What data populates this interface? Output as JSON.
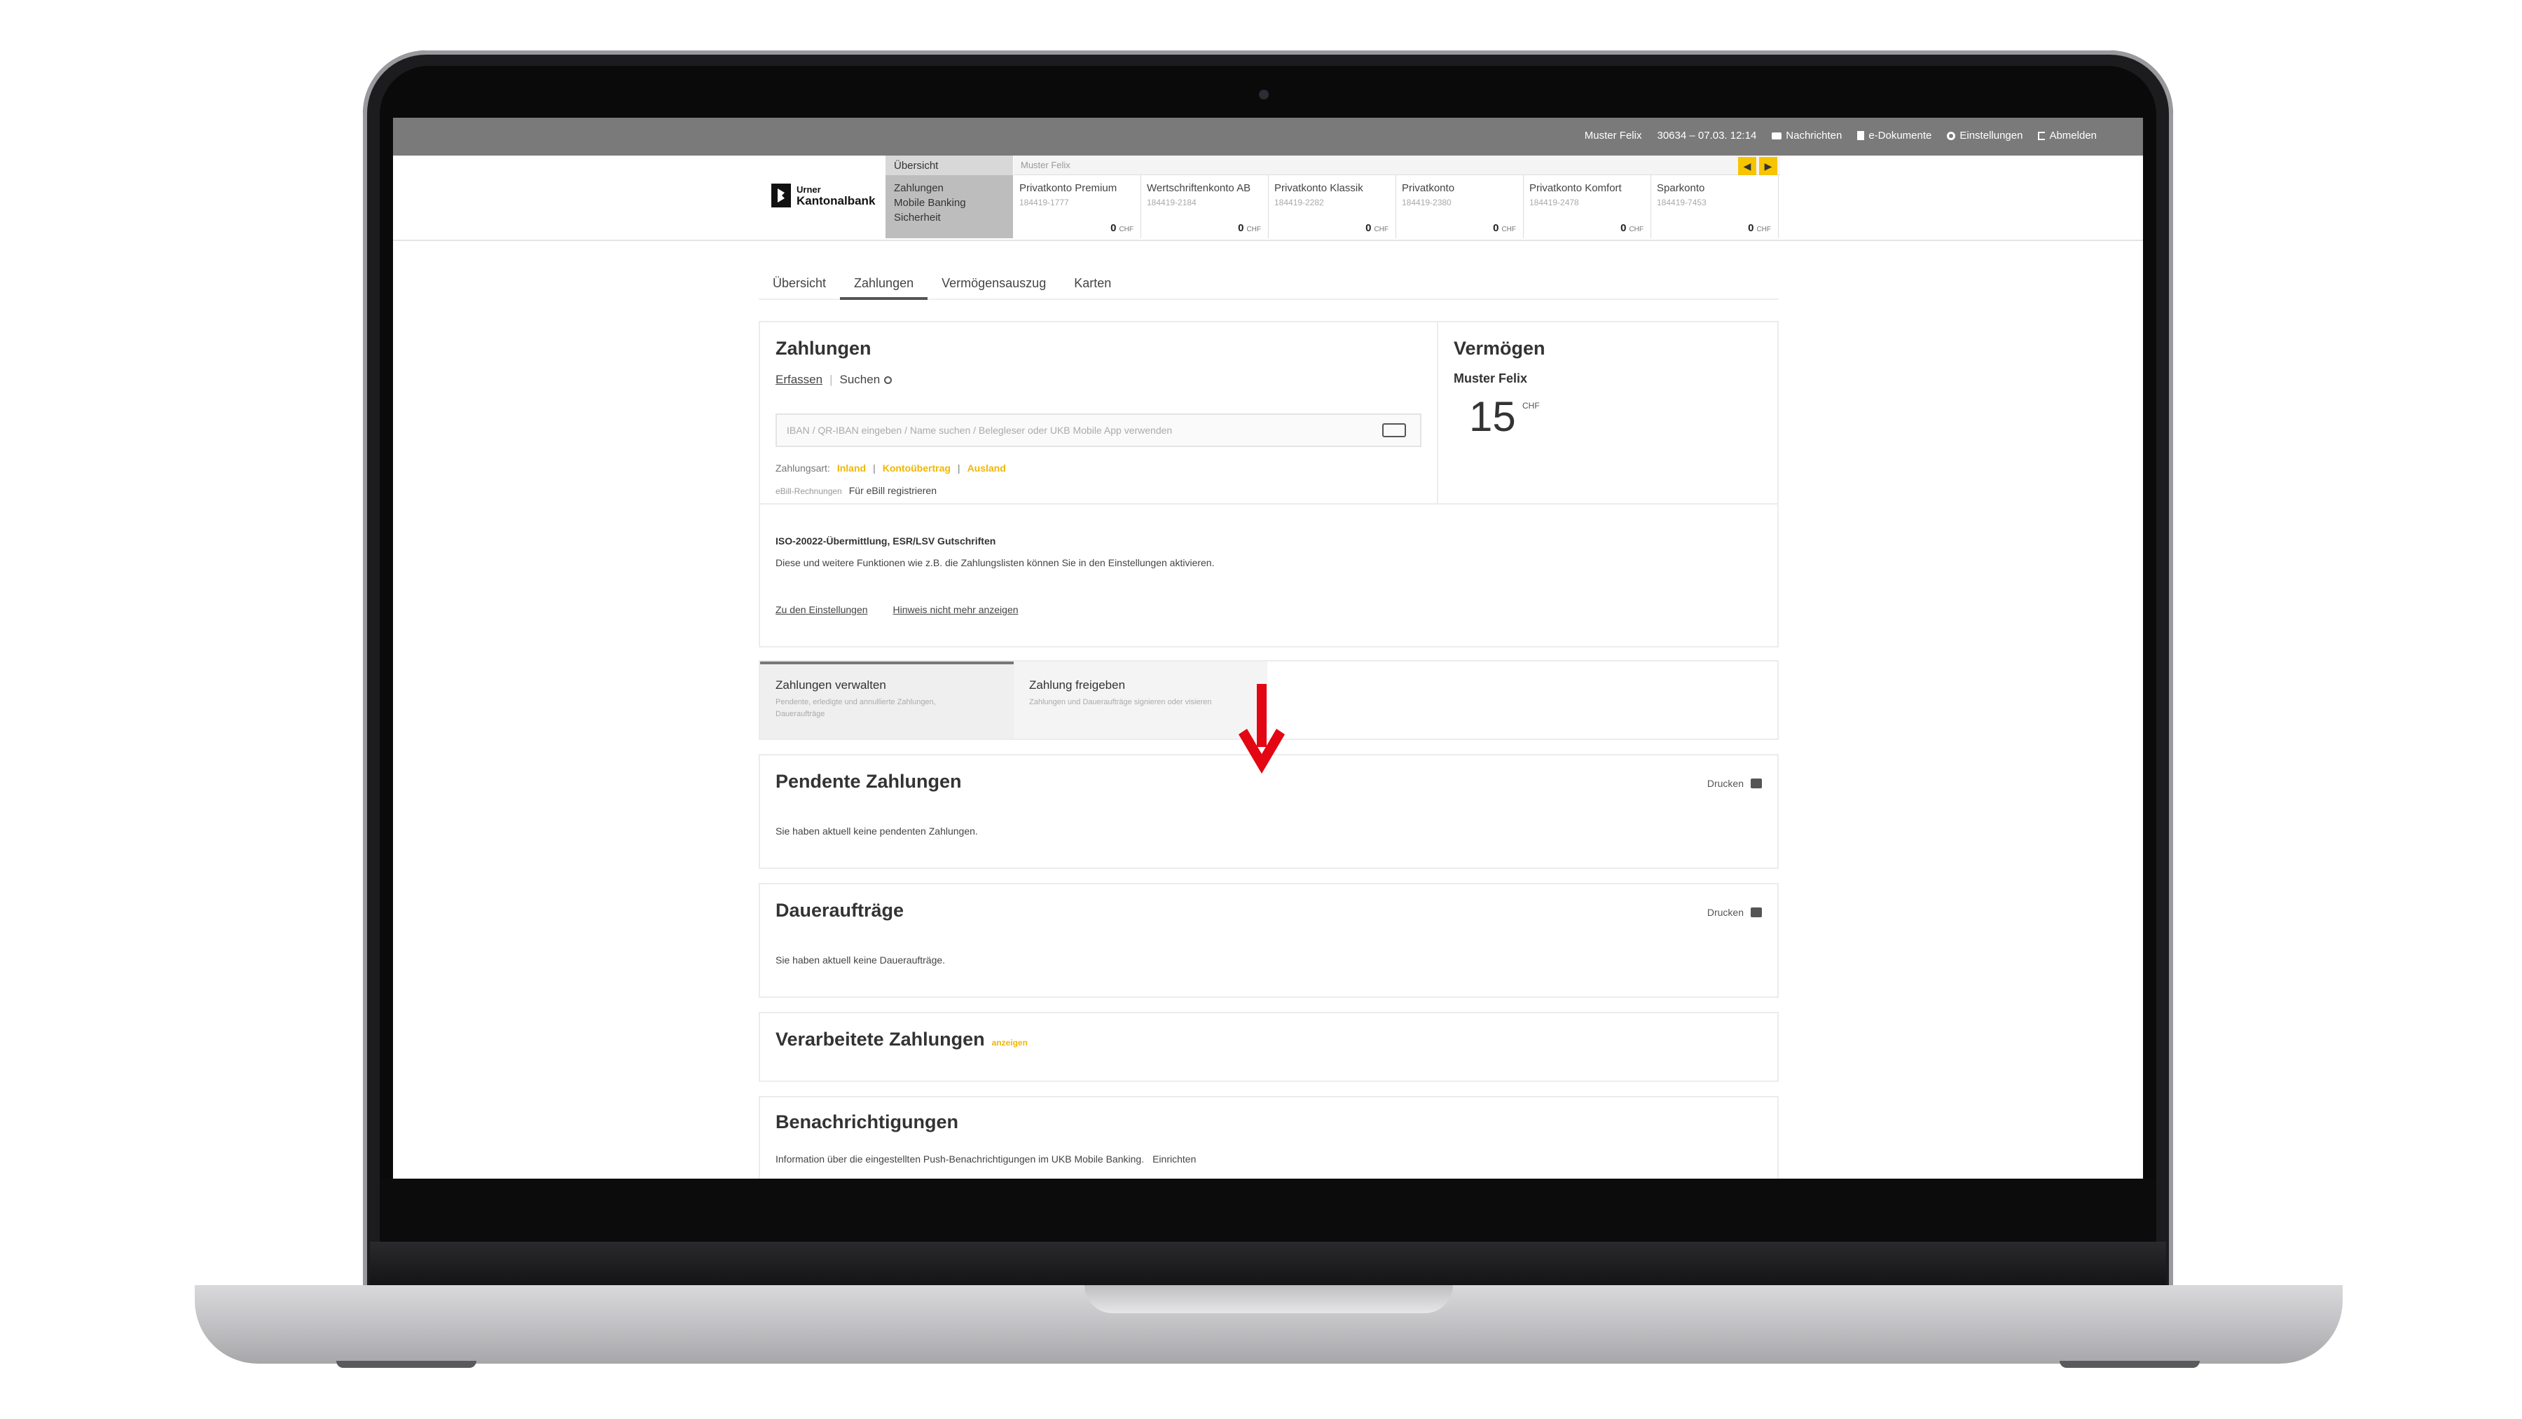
{
  "topbar": {
    "user": "Muster Felix",
    "session": "30634 – 07.03. 12:14",
    "messages": "Nachrichten",
    "documents": "e-Dokumente",
    "settings": "Einstellungen",
    "logout": "Abmelden"
  },
  "logo": {
    "line1": "Urner",
    "line2": "Kantonalbank"
  },
  "nav_menu": [
    "Übersicht",
    "Zahlungen",
    "Mobile Banking",
    "Sicherheit"
  ],
  "accounts_header": "Muster Felix",
  "accounts": [
    {
      "name": "Privatkonto Premium",
      "number": "184419-1777",
      "balance": "0",
      "currency": "CHF"
    },
    {
      "name": "Wertschriftenkonto AB",
      "number": "184419-2184",
      "balance": "0",
      "currency": "CHF"
    },
    {
      "name": "Privatkonto Klassik",
      "number": "184419-2282",
      "balance": "0",
      "currency": "CHF"
    },
    {
      "name": "Privatkonto",
      "number": "184419-2380",
      "balance": "0",
      "currency": "CHF"
    },
    {
      "name": "Privatkonto Komfort",
      "number": "184419-2478",
      "balance": "0",
      "currency": "CHF"
    },
    {
      "name": "Sparkonto",
      "number": "184419-7453",
      "balance": "0",
      "currency": "CHF"
    }
  ],
  "tabs": [
    "Übersicht",
    "Zahlungen",
    "Vermögensauszug",
    "Karten"
  ],
  "payments": {
    "title": "Zahlungen",
    "capture": "Erfassen",
    "search": "Suchen",
    "search_placeholder": "IBAN / QR-IBAN eingeben / Name suchen / Belegleser oder UKB Mobile App verwenden",
    "type_label": "Zahlungsart:",
    "type_inland": "Inland",
    "type_transfer": "Kontoübertrag",
    "type_abroad": "Ausland",
    "ebill_label": "eBill-Rechnungen",
    "ebill_register": "Für eBill registrieren"
  },
  "wealth": {
    "title": "Vermögen",
    "owner": "Muster Felix",
    "amount": "15",
    "currency": "CHF"
  },
  "notice": {
    "title": "ISO-20022-Übermittlung, ESR/LSV Gutschriften",
    "text": "Diese und weitere Funktionen wie z.B. die Zahlungslisten können Sie in den Einstellungen aktivieren.",
    "link_settings": "Zu den Einstellungen",
    "link_hide": "Hinweis nicht mehr anzeigen"
  },
  "subtabs": [
    {
      "title": "Zahlungen verwalten",
      "desc": "Pendente, erledigte und annullierte Zahlungen, Daueraufträge"
    },
    {
      "title": "Zahlung freigeben",
      "desc": "Zahlungen und Daueraufträge signieren oder visieren"
    }
  ],
  "pending": {
    "title": "Pendente Zahlungen",
    "print": "Drucken",
    "empty": "Sie haben aktuell keine pendenten Zahlungen."
  },
  "standing": {
    "title": "Daueraufträge",
    "print": "Drucken",
    "empty": "Sie haben aktuell keine Daueraufträge."
  },
  "processed": {
    "title": "Verarbeitete Zahlungen",
    "show": "anzeigen"
  },
  "notifications": {
    "title": "Benachrichtigungen",
    "text": "Information über die eingestellten Push-Benachrichtigungen im UKB Mobile Banking.",
    "setup": "Einrichten"
  },
  "colors": {
    "accent": "#f6c400",
    "arrow": "#e30613",
    "topbar": "#7a7a7a"
  }
}
